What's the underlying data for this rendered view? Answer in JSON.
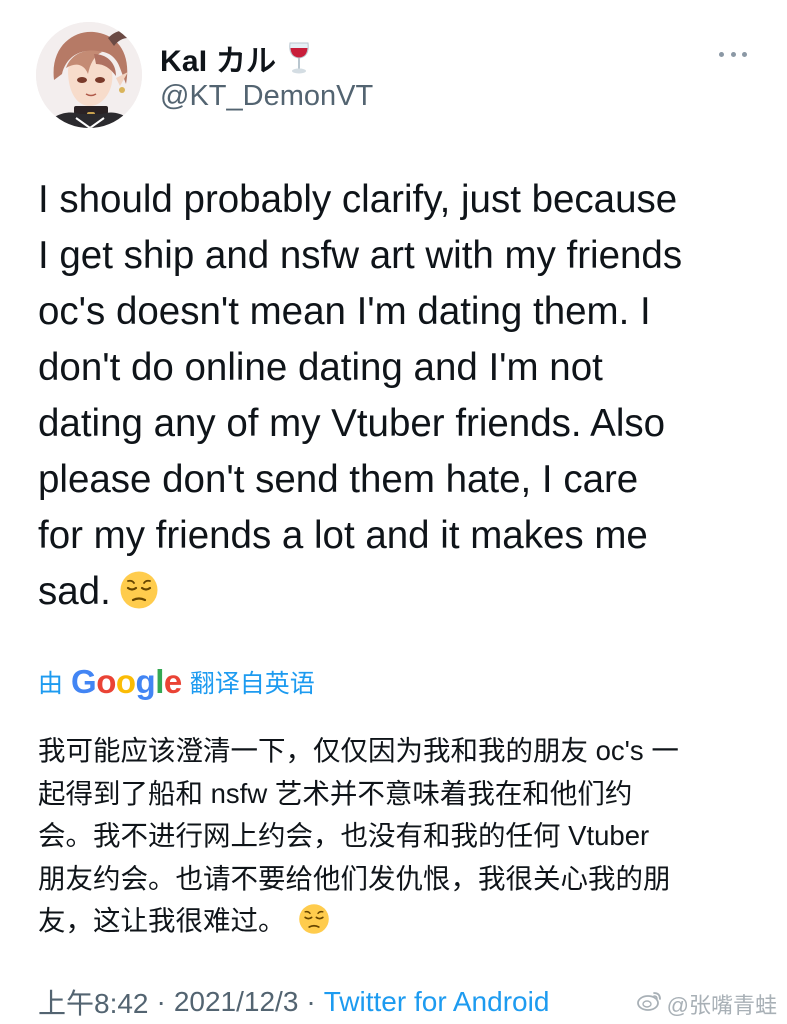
{
  "author": {
    "name": "KaI カル",
    "handle": "@KT_DemonVT",
    "name_emoji": "wine-glass-icon"
  },
  "more_menu": {
    "icon": "more-horizontal-icon"
  },
  "tweet": {
    "lines": [
      "I should probably clarify, just because",
      "I get ship and nsfw art with my friends",
      "oc's doesn't mean I'm dating them. I",
      "don't do online dating and I'm not",
      "dating any of my Vtuber friends. Also",
      "please don't send them hate, I care",
      "for my friends a lot and it makes me",
      "sad."
    ],
    "end_emoji": "pensive-face-icon"
  },
  "translation": {
    "prefix": "由",
    "provider": {
      "letters": [
        "G",
        "o",
        "o",
        "g",
        "l",
        "e"
      ]
    },
    "suffix": "翻译自英语",
    "lines": [
      "我可能应该澄清一下，仅仅因为我和我的朋友 oc's 一",
      "起得到了船和 nsfw 艺术并不意味着我在和他们约",
      "会。我不进行网上约会，也没有和我的任何 Vtuber",
      "朋友约会。也请不要给他们发仇恨，我很关心我的朋",
      "友，这让我很难过。"
    ],
    "end_emoji": "pensive-face-icon"
  },
  "meta": {
    "time": "上午8:42",
    "separator": "·",
    "date": "2021/12/3",
    "source": "Twitter for Android"
  },
  "watermark": {
    "text": "@张嘴青蛙",
    "icon": "weibo-logo-icon"
  },
  "colors": {
    "text": "#0f1419",
    "secondary": "#536471",
    "link": "#1d9bf0"
  }
}
